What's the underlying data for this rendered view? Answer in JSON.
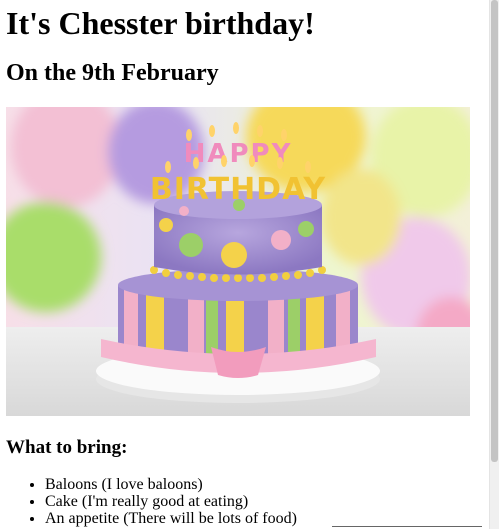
{
  "heading": "It's Chesster birthday!",
  "subheading": "On the 9th February",
  "image": {
    "name": "birthday-cake-photo",
    "cake_text_top": "HAPPY",
    "cake_text_bottom": "BIRTHDAY",
    "colors": {
      "cake_purple": "#9a86cc",
      "cake_pink": "#f2b0c8",
      "cake_yellow": "#f4d24a",
      "cake_green": "#9ccf68",
      "plate": "#f4f4f4"
    }
  },
  "bring": {
    "title": "What to bring:",
    "items": [
      "Baloons (I love baloons)",
      "Cake (I'm really good at eating)",
      "An appetite (There will be lots of food)"
    ]
  }
}
